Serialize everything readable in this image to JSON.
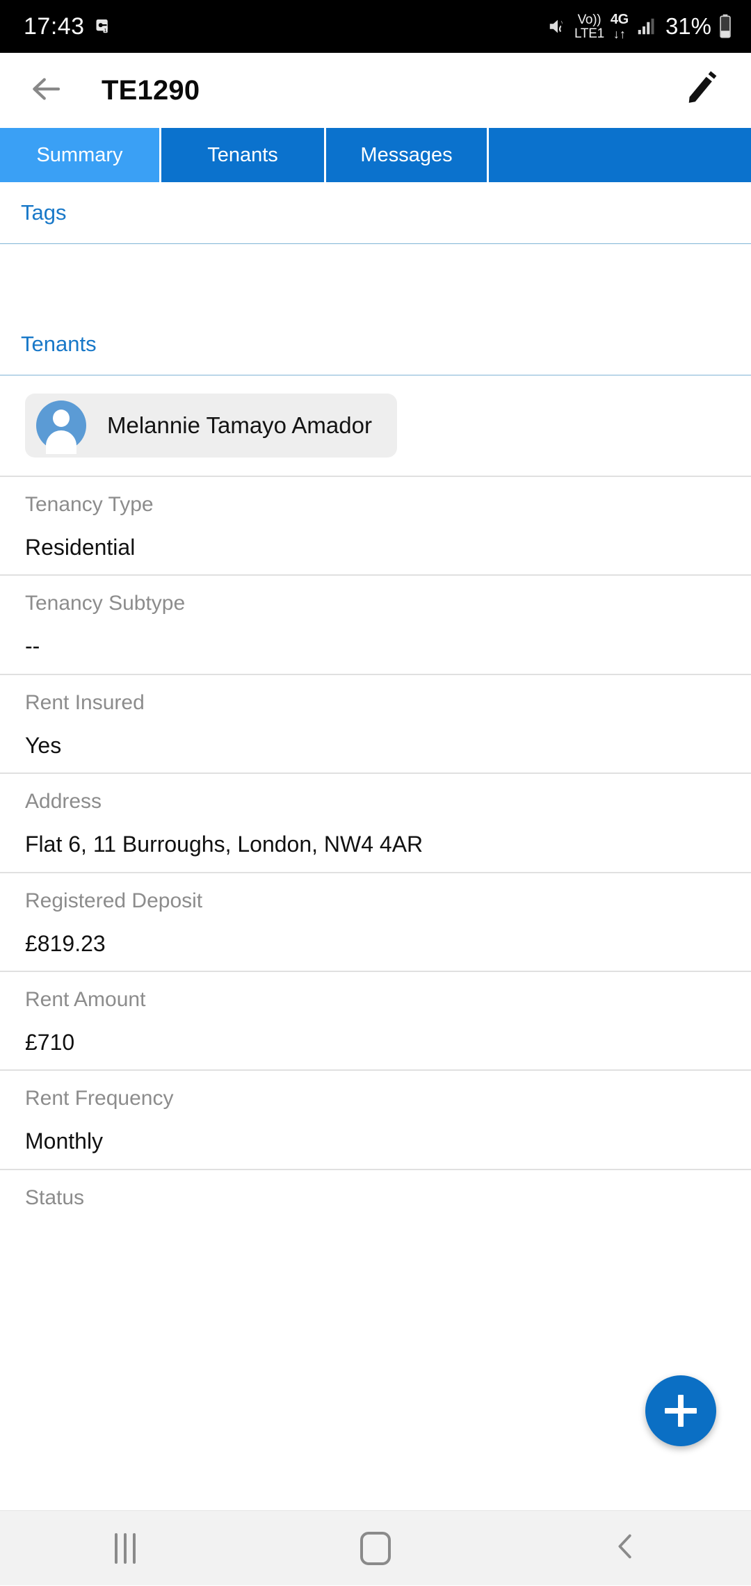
{
  "status_bar": {
    "time": "17:43",
    "left_icons": [
      "dual-sim-icon"
    ],
    "mute_icon": "volume-mute-icon",
    "volte_line1": "Vo))",
    "volte_line2": "LTE1",
    "network_type": "4G",
    "data_arrows": "↓↑",
    "signal_icon": "signal-bars-icon",
    "battery_percent": "31%",
    "battery_icon": "battery-icon"
  },
  "app_bar": {
    "back_icon": "back-arrow-icon",
    "title": "TE1290",
    "edit_icon": "edit-pencil-icon"
  },
  "tabs": {
    "active_index": 0,
    "items": [
      {
        "label": "Summary"
      },
      {
        "label": "Tenants"
      },
      {
        "label": "Messages"
      },
      {
        "label": ""
      }
    ]
  },
  "sections": {
    "tags": {
      "title": "Tags"
    },
    "tenants": {
      "title": "Tenants"
    }
  },
  "tenant": {
    "avatar_icon": "person-avatar-icon",
    "name": "Melannie Tamayo Amador"
  },
  "fields": [
    {
      "label": "Tenancy Type",
      "value": "Residential"
    },
    {
      "label": "Tenancy Subtype",
      "value": "--"
    },
    {
      "label": "Rent Insured",
      "value": "Yes"
    },
    {
      "label": "Address",
      "value": "Flat 6, 11 Burroughs, London, NW4 4AR"
    },
    {
      "label": "Registered Deposit",
      "value": "£819.23"
    },
    {
      "label": "Rent Amount",
      "value": "£710"
    },
    {
      "label": "Rent Frequency",
      "value": "Monthly"
    },
    {
      "label": "Status",
      "value": ""
    }
  ],
  "fab": {
    "icon": "plus-icon",
    "label": "+"
  },
  "nav_bar": {
    "recents_icon": "recents-icon",
    "home_icon": "home-icon",
    "back_icon": "back-chevron-icon"
  },
  "colors": {
    "accent_blue": "#0b72cd",
    "active_tab_blue": "#3aa0f5",
    "section_title_blue": "#1878c8",
    "avatar_blue": "#5b9bd5",
    "fab_blue": "#0b6fc4",
    "label_gray": "#8c8c8c"
  }
}
